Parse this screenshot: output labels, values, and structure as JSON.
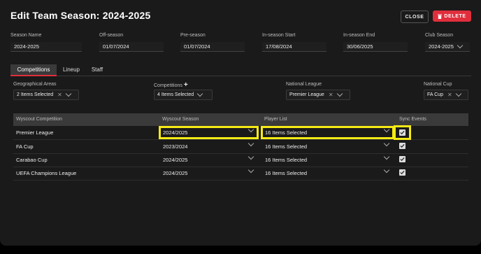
{
  "header": {
    "title": "Edit Team Season: 2024-2025",
    "close_label": "CLOSE",
    "delete_label": "DELETE"
  },
  "fields": {
    "season_name": {
      "label": "Season Name",
      "value": "2024-2025"
    },
    "off_season": {
      "label": "Off-season",
      "value": "01/07/2024"
    },
    "pre_season": {
      "label": "Pre-season",
      "value": "01/07/2024"
    },
    "in_season_start": {
      "label": "In-season Start",
      "value": "17/08/2024"
    },
    "in_season_end": {
      "label": "In-season End",
      "value": "30/06/2025"
    },
    "club_season": {
      "label": "Club Season",
      "value": "2024-2025"
    }
  },
  "tabs": [
    {
      "label": "Competitions"
    },
    {
      "label": "Lineup"
    },
    {
      "label": "Staff"
    }
  ],
  "filters": {
    "geo": {
      "label": "Geographical Areas",
      "value": "2 Items Selected"
    },
    "competitions": {
      "label": "Competitions",
      "value": "4 Items Selected"
    },
    "national_league": {
      "label": "National League",
      "value": "Premier League"
    },
    "national_cup": {
      "label": "National Cup",
      "value": "FA Cup"
    }
  },
  "table": {
    "headers": [
      "Wyscout Competition",
      "Wyscout Season",
      "Player List",
      "Sync Events"
    ],
    "rows": [
      {
        "competition": "Premier League",
        "season": "2024/2025",
        "players": "16 Items Selected",
        "sync": true
      },
      {
        "competition": "FA Cup",
        "season": "2023/2024",
        "players": "16 Items Selected",
        "sync": true
      },
      {
        "competition": "Carabao Cup",
        "season": "2024/2025",
        "players": "16 Items Selected",
        "sync": true
      },
      {
        "competition": "UEFA Champions League",
        "season": "2024/2025",
        "players": "16 Items Selected",
        "sync": true
      }
    ]
  },
  "colors": {
    "accent": "#e02e3c",
    "highlight": "#f5ea14"
  }
}
